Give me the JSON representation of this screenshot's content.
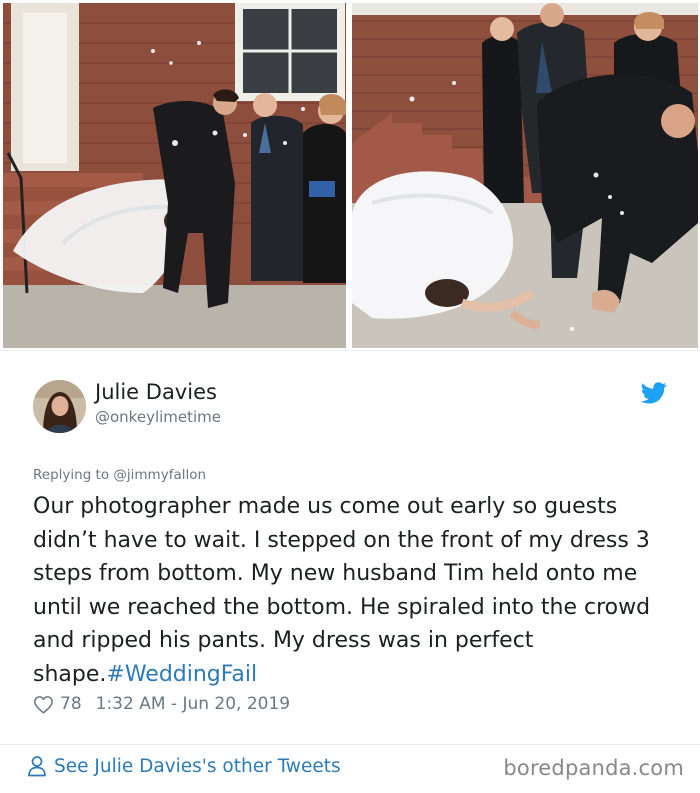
{
  "photos": {
    "left_icon": "wedding-photo-stairs-fall",
    "right_icon": "wedding-photo-crawling-bride"
  },
  "tweet": {
    "display_name": "Julie Davies",
    "handle": "@onkeylimetime",
    "avatar_icon": "profile-photo",
    "platform_icon": "twitter-bird-icon",
    "reply_prefix": "Replying to ",
    "reply_mention": "@jimmyfallon",
    "body_text": "Our photographer made us come out early so guests didn’t have to wait. I stepped on the front of my dress 3 steps from bottom. My new husband Tim held onto me until we reached the bottom. He spiraled into the crowd and ripped his pants. My dress was in perfect shape.",
    "hashtag": "#WeddingFail",
    "like_count": "78",
    "timestamp": "1:32 AM - Jun 20, 2019"
  },
  "footer": {
    "see_more_label": "See Julie Davies's other Tweets",
    "watermark": "boredpanda.com"
  },
  "colors": {
    "link_blue": "#2b7bb9",
    "secondary_gray": "#697882",
    "text_dark": "#1c2022",
    "twitter_blue": "#1da1f2"
  }
}
